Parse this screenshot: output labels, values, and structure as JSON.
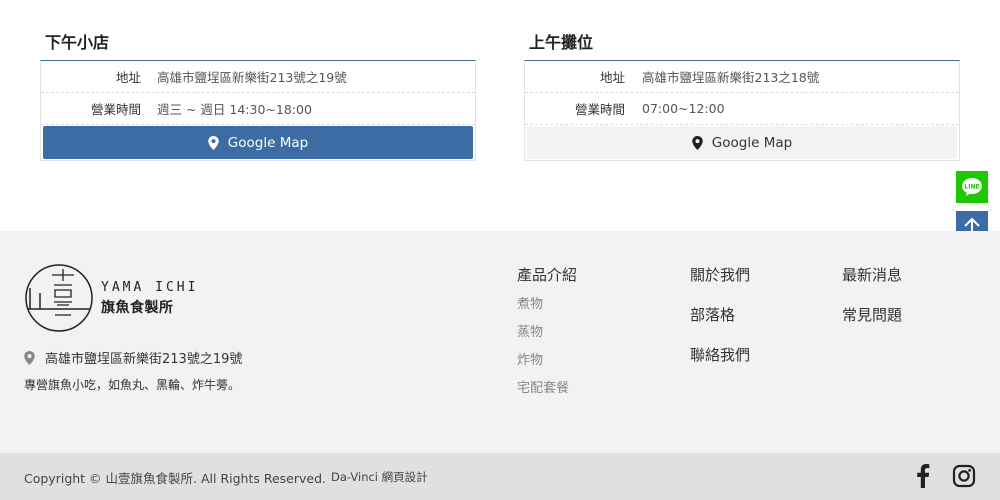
{
  "stores": [
    {
      "title": "下午小店",
      "address_label": "地址",
      "address_value": "高雄市鹽埕區新樂街213號之19號",
      "hours_label": "營業時間",
      "hours_value": "週三 ~ 週日 14:30~18:00",
      "map_label": "Google Map"
    },
    {
      "title": "上午攤位",
      "address_label": "地址",
      "address_value": "高雄市鹽埕區新樂街213之18號",
      "hours_label": "營業時間",
      "hours_value": "07:00~12:00",
      "map_label": "Google Map"
    }
  ],
  "floating": {
    "line_label": "LINE"
  },
  "footer": {
    "logo_en": "YAMA ICHI",
    "logo_zh": "旗魚食製所",
    "address": "高雄市鹽埕區新樂街213號之19號",
    "description": "專營旗魚小吃，如魚丸、黑輪、炸牛蒡。",
    "products": {
      "title": "產品介紹",
      "items": [
        "煮物",
        "蒸物",
        "炸物",
        "宅配套餐"
      ]
    },
    "nav2": [
      "關於我們",
      "部落格",
      "聯絡我們"
    ],
    "nav3": [
      "最新消息",
      "常見問題"
    ],
    "copyright": "Copyright © 山壹旗魚食製所. All Rights Reserved.",
    "designer": "Da-Vinci 網頁設計"
  },
  "colors": {
    "primary": "#3c6ca3",
    "line_green": "#1fc700",
    "footer_bg": "#f2f2f2",
    "bottom_bar_bg": "#e0e0e0"
  },
  "icons": [
    "map-pin-icon",
    "line-icon",
    "arrow-up-icon",
    "facebook-icon",
    "instagram-icon"
  ]
}
